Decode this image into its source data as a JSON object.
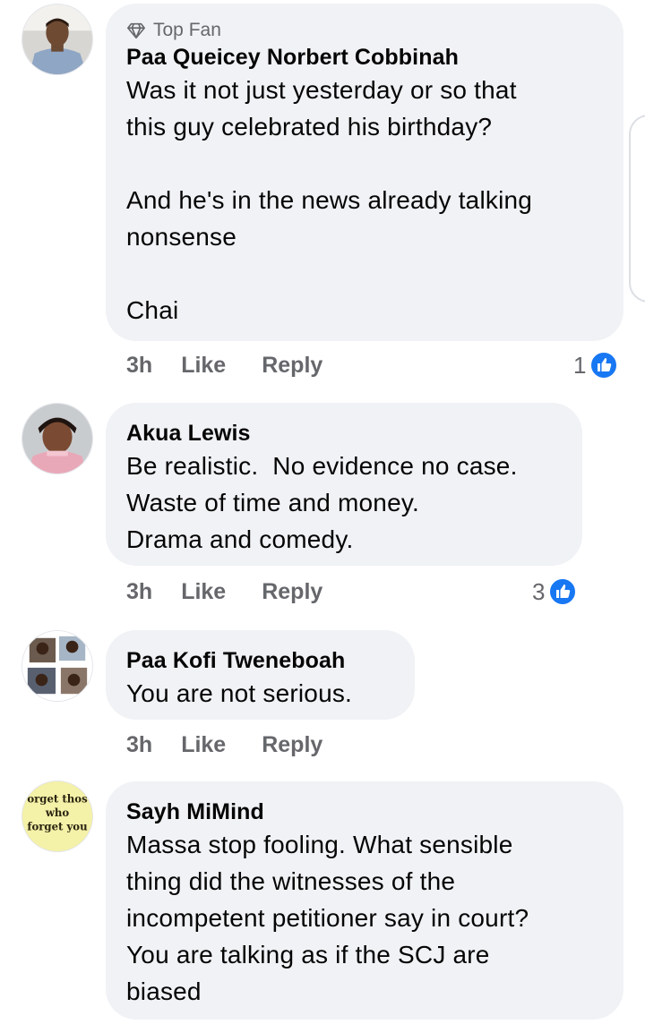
{
  "comments": [
    {
      "badge": "Top Fan",
      "author": "Paa Queicey Norbert Cobbinah",
      "text": "Was it not just yesterday or so that\nthis guy celebrated his birthday?\n\nAnd he's in the news already talking\nnonsense\n\nChai",
      "time": "3h",
      "like": "Like",
      "reply": "Reply",
      "reactions": "1"
    },
    {
      "author": "Akua Lewis",
      "text": "Be realistic.  No evidence no case.\nWaste of time and money.\nDrama and comedy.",
      "time": "3h",
      "like": "Like",
      "reply": "Reply",
      "reactions": "3"
    },
    {
      "author": "Paa Kofi Tweneboah",
      "text": "You are not serious.",
      "time": "3h",
      "like": "Like",
      "reply": "Reply"
    },
    {
      "author": "Sayh MiMind",
      "avatar_text": [
        "orget thos",
        "who",
        "forget you"
      ],
      "text": "Massa stop fooling. What sensible\nthing did the witnesses of the\nincompetent petitioner say in court?\nYou are talking as if the SCJ are\nbiased"
    }
  ],
  "colors": {
    "bubble": "#f0f2f5",
    "meta": "#65676b",
    "like_blue": "#1877f2"
  },
  "icons": [
    "top-fan-diamond-icon",
    "like-reaction-icon"
  ]
}
